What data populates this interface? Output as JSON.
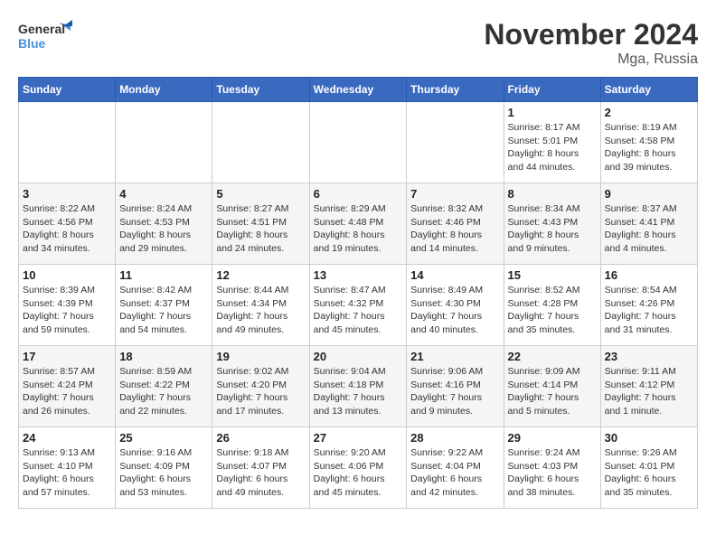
{
  "logo": {
    "line1": "General",
    "line2": "Blue"
  },
  "title": "November 2024",
  "location": "Mga, Russia",
  "weekdays": [
    "Sunday",
    "Monday",
    "Tuesday",
    "Wednesday",
    "Thursday",
    "Friday",
    "Saturday"
  ],
  "weeks": [
    [
      {
        "day": "",
        "info": ""
      },
      {
        "day": "",
        "info": ""
      },
      {
        "day": "",
        "info": ""
      },
      {
        "day": "",
        "info": ""
      },
      {
        "day": "",
        "info": ""
      },
      {
        "day": "1",
        "info": "Sunrise: 8:17 AM\nSunset: 5:01 PM\nDaylight: 8 hours and 44 minutes."
      },
      {
        "day": "2",
        "info": "Sunrise: 8:19 AM\nSunset: 4:58 PM\nDaylight: 8 hours and 39 minutes."
      }
    ],
    [
      {
        "day": "3",
        "info": "Sunrise: 8:22 AM\nSunset: 4:56 PM\nDaylight: 8 hours and 34 minutes."
      },
      {
        "day": "4",
        "info": "Sunrise: 8:24 AM\nSunset: 4:53 PM\nDaylight: 8 hours and 29 minutes."
      },
      {
        "day": "5",
        "info": "Sunrise: 8:27 AM\nSunset: 4:51 PM\nDaylight: 8 hours and 24 minutes."
      },
      {
        "day": "6",
        "info": "Sunrise: 8:29 AM\nSunset: 4:48 PM\nDaylight: 8 hours and 19 minutes."
      },
      {
        "day": "7",
        "info": "Sunrise: 8:32 AM\nSunset: 4:46 PM\nDaylight: 8 hours and 14 minutes."
      },
      {
        "day": "8",
        "info": "Sunrise: 8:34 AM\nSunset: 4:43 PM\nDaylight: 8 hours and 9 minutes."
      },
      {
        "day": "9",
        "info": "Sunrise: 8:37 AM\nSunset: 4:41 PM\nDaylight: 8 hours and 4 minutes."
      }
    ],
    [
      {
        "day": "10",
        "info": "Sunrise: 8:39 AM\nSunset: 4:39 PM\nDaylight: 7 hours and 59 minutes."
      },
      {
        "day": "11",
        "info": "Sunrise: 8:42 AM\nSunset: 4:37 PM\nDaylight: 7 hours and 54 minutes."
      },
      {
        "day": "12",
        "info": "Sunrise: 8:44 AM\nSunset: 4:34 PM\nDaylight: 7 hours and 49 minutes."
      },
      {
        "day": "13",
        "info": "Sunrise: 8:47 AM\nSunset: 4:32 PM\nDaylight: 7 hours and 45 minutes."
      },
      {
        "day": "14",
        "info": "Sunrise: 8:49 AM\nSunset: 4:30 PM\nDaylight: 7 hours and 40 minutes."
      },
      {
        "day": "15",
        "info": "Sunrise: 8:52 AM\nSunset: 4:28 PM\nDaylight: 7 hours and 35 minutes."
      },
      {
        "day": "16",
        "info": "Sunrise: 8:54 AM\nSunset: 4:26 PM\nDaylight: 7 hours and 31 minutes."
      }
    ],
    [
      {
        "day": "17",
        "info": "Sunrise: 8:57 AM\nSunset: 4:24 PM\nDaylight: 7 hours and 26 minutes."
      },
      {
        "day": "18",
        "info": "Sunrise: 8:59 AM\nSunset: 4:22 PM\nDaylight: 7 hours and 22 minutes."
      },
      {
        "day": "19",
        "info": "Sunrise: 9:02 AM\nSunset: 4:20 PM\nDaylight: 7 hours and 17 minutes."
      },
      {
        "day": "20",
        "info": "Sunrise: 9:04 AM\nSunset: 4:18 PM\nDaylight: 7 hours and 13 minutes."
      },
      {
        "day": "21",
        "info": "Sunrise: 9:06 AM\nSunset: 4:16 PM\nDaylight: 7 hours and 9 minutes."
      },
      {
        "day": "22",
        "info": "Sunrise: 9:09 AM\nSunset: 4:14 PM\nDaylight: 7 hours and 5 minutes."
      },
      {
        "day": "23",
        "info": "Sunrise: 9:11 AM\nSunset: 4:12 PM\nDaylight: 7 hours and 1 minute."
      }
    ],
    [
      {
        "day": "24",
        "info": "Sunrise: 9:13 AM\nSunset: 4:10 PM\nDaylight: 6 hours and 57 minutes."
      },
      {
        "day": "25",
        "info": "Sunrise: 9:16 AM\nSunset: 4:09 PM\nDaylight: 6 hours and 53 minutes."
      },
      {
        "day": "26",
        "info": "Sunrise: 9:18 AM\nSunset: 4:07 PM\nDaylight: 6 hours and 49 minutes."
      },
      {
        "day": "27",
        "info": "Sunrise: 9:20 AM\nSunset: 4:06 PM\nDaylight: 6 hours and 45 minutes."
      },
      {
        "day": "28",
        "info": "Sunrise: 9:22 AM\nSunset: 4:04 PM\nDaylight: 6 hours and 42 minutes."
      },
      {
        "day": "29",
        "info": "Sunrise: 9:24 AM\nSunset: 4:03 PM\nDaylight: 6 hours and 38 minutes."
      },
      {
        "day": "30",
        "info": "Sunrise: 9:26 AM\nSunset: 4:01 PM\nDaylight: 6 hours and 35 minutes."
      }
    ]
  ]
}
